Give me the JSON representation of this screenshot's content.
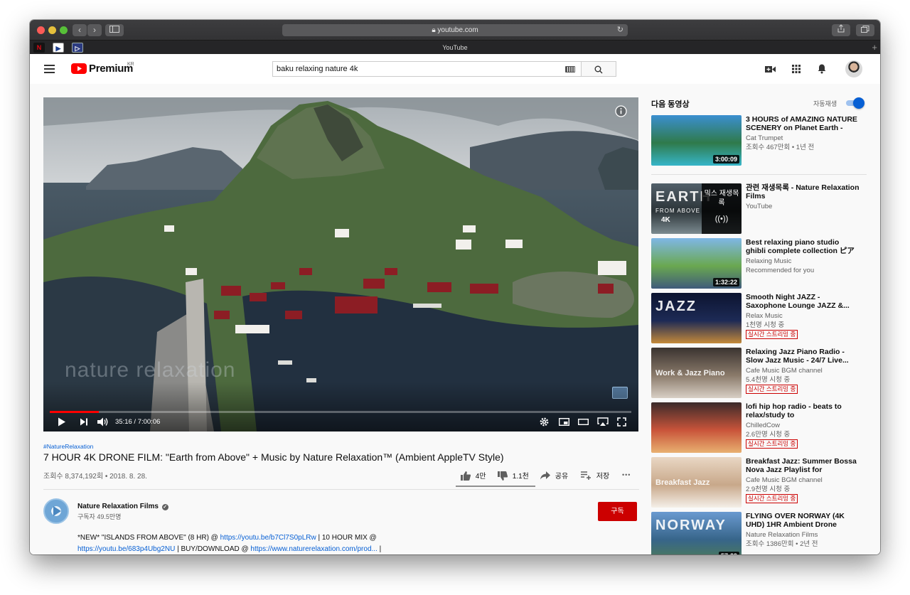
{
  "browser": {
    "url": "youtube.com",
    "tab_title": "YouTube",
    "back_icon": "‹",
    "forward_icon": "›"
  },
  "header": {
    "logo_text": "Premium",
    "region": "KR",
    "search_value": "baku relaxing nature 4k"
  },
  "video": {
    "current_time": "35:16 / 7:00:06",
    "watermark_brand": "nature relaxation",
    "progress_fraction": 0.084,
    "hashtag": "#NatureRelaxation",
    "title": "7 HOUR 4K DRONE FILM: \"Earth from Above\" + Music by Nature Relaxation™ (Ambient AppleTV Style)",
    "views_date": "조회수 8,374,192회 • 2018. 8. 28.",
    "likes": "4만",
    "dislikes": "1.1천",
    "share_label": "공유",
    "save_label": "저장",
    "more_label": "•••"
  },
  "channel": {
    "name": "Nature Relaxation Films",
    "subscribers": "구독자 49.5만명",
    "subscribe_label": "구독",
    "desc_line1_prefix": "*NEW* \"ISLANDS FROM ABOVE\" (8 HR) @ ",
    "desc_link1": "https://youtu.be/b7Cl7S0pLRw",
    "desc_line1_mid": " | 10 HOUR MIX @",
    "desc_link2": "https://youtu.be/683p4Ubg2NU",
    "desc_line2_mid": " | BUY/DOWNLOAD @  ",
    "desc_link3": "https://www.naturerelaxation.com/prod...",
    "desc_line2_suffix": " |"
  },
  "sidebar": {
    "up_next": "다음 동영상",
    "autoplay_label": "자동재생",
    "autoplay_on": true,
    "items": [
      {
        "title": "3 HOURS of AMAZING NATURE SCENERY on Planet Earth - Th...",
        "channel": "Cat Trumpet",
        "meta": "조회수 467만회 • 1년 전",
        "duration": "3:00:09",
        "colors": [
          "#3b8fd0",
          "#2f7a4a",
          "#36b5c9"
        ]
      },
      {
        "title": "관련 재생목록 - Nature Relaxation Films",
        "channel": "YouTube",
        "meta": "",
        "overlay": "믹스 재생목록",
        "thumb_text": "EARTH",
        "thumb_sub": "FROM ABOVE",
        "thumb_badge": "4K",
        "colors": [
          "#52606a",
          "#2c3438",
          "#7b8a90"
        ]
      },
      {
        "title": "Best relaxing piano studio ghibli complete collection ピアノスタ...",
        "channel": "Relaxing Music",
        "meta": "Recommended for you",
        "duration": "1:32:22",
        "colors": [
          "#7fb7e6",
          "#6aa850",
          "#3f5a7a"
        ]
      },
      {
        "title": "Smooth Night JAZZ - Saxophone Lounge JAZZ &...",
        "channel": "Relax Music",
        "meta": "1천명 시청 중",
        "live": "실시간 스트리밍 중",
        "thumb_text": "JAZZ",
        "colors": [
          "#0c1430",
          "#1d2a55",
          "#c48a3a"
        ]
      },
      {
        "title": "Relaxing Jazz Piano Radio - Slow Jazz Music - 24/7 Live...",
        "channel": "Cafe Music BGM channel",
        "meta": "5.4천명 시청 중",
        "live": "실시간 스트리밍 중",
        "thumb_text": "Work & Jazz Piano",
        "colors": [
          "#3a3330",
          "#8a7a6a",
          "#d8cfc5"
        ]
      },
      {
        "title": "lofi hip hop radio - beats to relax/study to",
        "channel": "ChilledCow",
        "meta": "2.6만명 시청 중",
        "live": "실시간 스트리밍 중",
        "colors": [
          "#3b2a2a",
          "#c9543a",
          "#e8b070"
        ]
      },
      {
        "title": "Breakfast Jazz: Summer Bossa Nova Jazz Playlist for Morning...",
        "channel": "Cafe Music BGM channel",
        "meta": "2.9천명 시청 중",
        "live": "실시간 스트리밍 중",
        "thumb_text": "Breakfast Jazz",
        "colors": [
          "#e9d7c4",
          "#c8a88a",
          "#f4efe8"
        ]
      },
      {
        "title": "FLYING OVER NORWAY (4K UHD) 1HR Ambient Drone Film...",
        "channel": "Nature Relaxation Films",
        "meta": "조회수 1386만회 • 2년 전",
        "duration": "57:29",
        "thumb_text": "NORWAY",
        "colors": [
          "#6a9ad0",
          "#37658a",
          "#4e7d55"
        ]
      }
    ]
  },
  "colors": {
    "yt_red": "#ff0000",
    "subscribe_red": "#cc0000",
    "progress_red": "#ff0000",
    "autoplay_blue": "#065fd4",
    "link_blue": "#065fd4"
  }
}
